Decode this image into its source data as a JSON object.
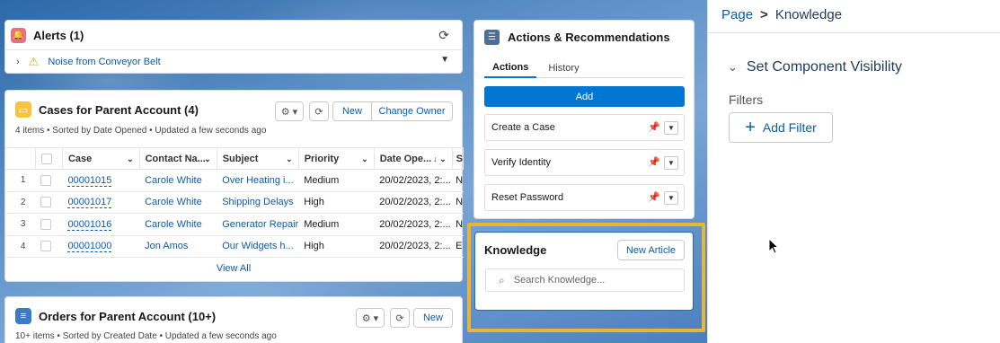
{
  "alerts": {
    "title": "Alerts (1)",
    "item": "Noise from Conveyor Belt"
  },
  "cases": {
    "title": "Cases for Parent Account (4)",
    "subtitle": "4 items • Sorted by Date Opened • Updated a few seconds ago",
    "new_label": "New",
    "change_owner_label": "Change Owner",
    "columns": [
      "Case",
      "Contact Na...",
      "Subject",
      "Priority",
      "Date Ope...",
      "S"
    ],
    "rows": [
      {
        "num": "1",
        "case": "00001015",
        "contact": "Carole White",
        "subject": "Over Heating i...",
        "priority": "Medium",
        "date": "20/02/2023, 2:...",
        "extra": "N"
      },
      {
        "num": "2",
        "case": "00001017",
        "contact": "Carole White",
        "subject": "Shipping Delays",
        "priority": "High",
        "date": "20/02/2023, 2:...",
        "extra": "N"
      },
      {
        "num": "3",
        "case": "00001016",
        "contact": "Carole White",
        "subject": "Generator Repair",
        "priority": "Medium",
        "date": "20/02/2023, 2:...",
        "extra": "N"
      },
      {
        "num": "4",
        "case": "00001000",
        "contact": "Jon Amos",
        "subject": "Our Widgets h...",
        "priority": "High",
        "date": "20/02/2023, 2:...",
        "extra": "E"
      }
    ],
    "view_all": "View All"
  },
  "orders": {
    "title": "Orders for Parent Account (10+)",
    "subtitle": "10+ items • Sorted by Created Date • Updated a few seconds ago",
    "new_label": "New"
  },
  "actions": {
    "title": "Actions & Recommendations",
    "tabs": [
      "Actions",
      "History"
    ],
    "add_label": "Add",
    "items": [
      "Create a Case",
      "Verify Identity",
      "Reset Password"
    ]
  },
  "knowledge": {
    "title": "Knowledge",
    "new_article_label": "New Article",
    "search_placeholder": "Search Knowledge..."
  },
  "panel": {
    "breadcrumb_page": "Page",
    "breadcrumb_sep": ">",
    "breadcrumb_current": "Knowledge",
    "section_title": "Set Component Visibility",
    "filters_label": "Filters",
    "add_filter_label": "Add Filter"
  },
  "colors": {
    "brand_blue": "#0176d3",
    "highlight": "#e8b630",
    "link": "#0b5cab"
  }
}
